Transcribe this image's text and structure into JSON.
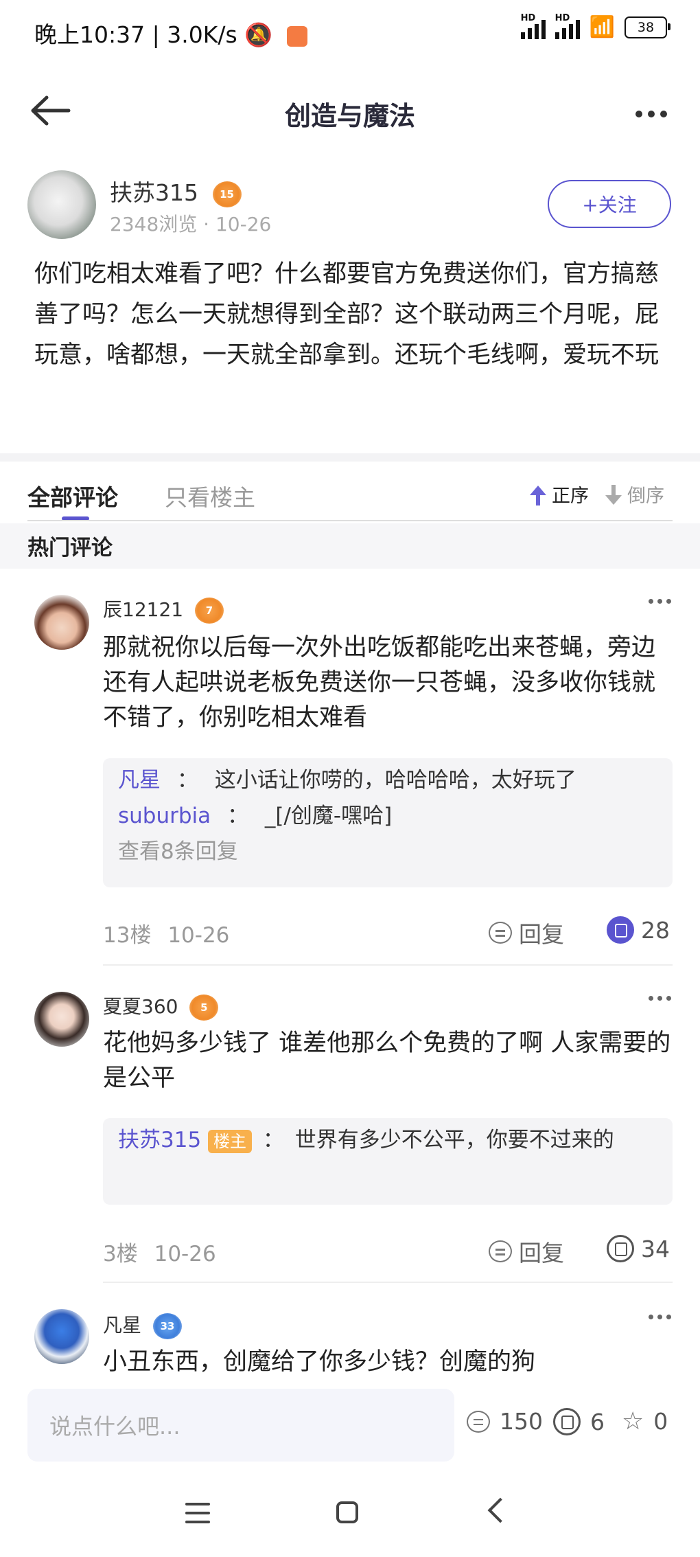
{
  "status_bar": {
    "time": "晚上10:37",
    "speed": "3.0K/s",
    "net1": "HD",
    "net2": "HD",
    "battery": "38"
  },
  "header": {
    "title": "创造与魔法"
  },
  "post": {
    "author": "扶苏315",
    "author_level": "15",
    "views": "2348浏览",
    "date": "· 10-26",
    "follow_label": "+关注",
    "body": "你们吃相太难看了吧？什么都要官方免费送你们，官方搞慈善了吗？怎么一天就想得到全部？这个联动两三个月呢，屁玩意，啥都想，一天就全部拿到。还玩个毛线啊，爱玩不玩"
  },
  "tabs": {
    "all": "全部评论",
    "host_only": "只看楼主",
    "sort_asc": "正序",
    "sort_desc": "倒序"
  },
  "hot_title": "热门评论",
  "comments": [
    {
      "name": "辰12121",
      "level": "7",
      "text": "那就祝你以后每一次外出吃饭都能吃出来苍蝇，旁边还有人起哄说老板免费送你一只苍蝇，没多收你钱就不错了，你别吃相太难看",
      "replies": [
        {
          "user": "凡星",
          "sep": "：",
          "text": "这小话让你唠的，哈哈哈哈，太好玩了"
        },
        {
          "user": "suburbia",
          "sep": "：",
          "text": "_[/创魔-嘿哈]"
        }
      ],
      "more_replies": "查看8条回复",
      "floor": "13楼",
      "date": "10-26",
      "reply_label": "回复",
      "likes": "28"
    },
    {
      "name": "夏夏360",
      "level": "5",
      "text": "花他妈多少钱了 谁差他那么个免费的了啊 人家需要的是公平",
      "replies": [
        {
          "user": "扶苏315",
          "tag": "楼主",
          "sep": "：",
          "text": "世界有多少不公平，你要不过来的"
        }
      ],
      "floor": "3楼",
      "date": "10-26",
      "reply_label": "回复",
      "likes": "34"
    },
    {
      "name": "凡星",
      "level": "33",
      "text": "小丑东西，创魔给了你多少钱？创魔的狗"
    }
  ],
  "bottom": {
    "placeholder": "说点什么吧...",
    "comments": "150",
    "likes": "6",
    "stars": "0"
  }
}
